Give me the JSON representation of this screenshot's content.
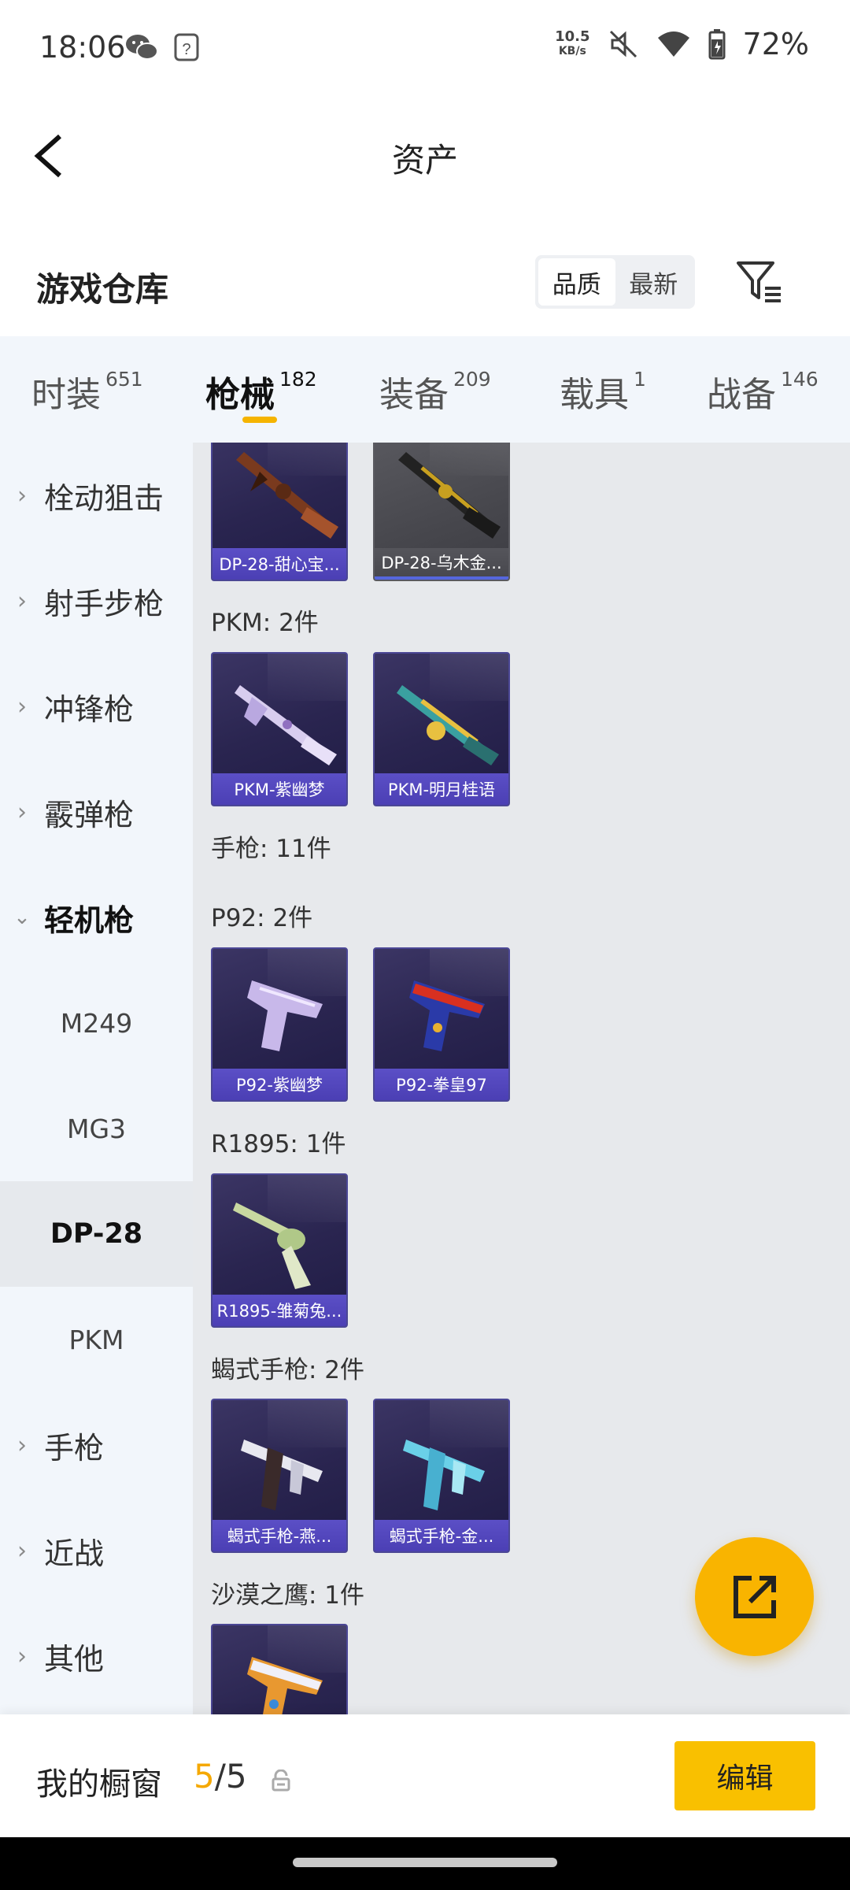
{
  "status_bar": {
    "time": "18:06",
    "net_speed_value": "10.5",
    "net_speed_unit": "KB/s",
    "battery": "72%"
  },
  "header": {
    "title": "资产"
  },
  "warehouse": {
    "title": "游戏仓库",
    "sort_options": [
      "品质",
      "最新"
    ],
    "active_sort": "品质"
  },
  "category_tabs": [
    {
      "label": "时装",
      "count": "651"
    },
    {
      "label": "枪械",
      "count": "182"
    },
    {
      "label": "装备",
      "count": "209"
    },
    {
      "label": "载具",
      "count": "1"
    },
    {
      "label": "战备",
      "count": "146"
    }
  ],
  "active_tab": "枪械",
  "sidebar": {
    "items": [
      {
        "label": "栓动狙击"
      },
      {
        "label": "射手步枪"
      },
      {
        "label": "冲锋枪"
      },
      {
        "label": "霰弹枪"
      },
      {
        "label": "轻机枪"
      },
      {
        "label": "M249"
      },
      {
        "label": "MG3"
      },
      {
        "label": "DP-28"
      },
      {
        "label": "PKM"
      },
      {
        "label": "手枪"
      },
      {
        "label": "近战"
      },
      {
        "label": "其他"
      }
    ],
    "selected": "DP-28"
  },
  "content": {
    "groups": [
      {
        "label": "PKM: 2件"
      },
      {
        "label": "手枪: 11件"
      },
      {
        "label": "P92: 2件"
      },
      {
        "label": "R1895: 1件"
      },
      {
        "label": "蝎式手枪: 2件"
      },
      {
        "label": "沙漠之鹰: 1件"
      }
    ],
    "cards": [
      {
        "name": "DP-28-甜心宝..."
      },
      {
        "name": "DP-28-乌木金..."
      },
      {
        "name": "PKM-紫幽梦"
      },
      {
        "name": "PKM-明月桂语"
      },
      {
        "name": "P92-紫幽梦"
      },
      {
        "name": "P92-拳皇97"
      },
      {
        "name": "R1895-雏菊兔..."
      },
      {
        "name": "蝎式手枪-燕..."
      },
      {
        "name": "蝎式手枪-金..."
      },
      {
        "name": ""
      }
    ]
  },
  "bottom_bar": {
    "my_window_label": "我的橱窗",
    "count_current": "5",
    "count_sep": "/",
    "count_total": "5",
    "edit_label": "编辑"
  },
  "colors": {
    "accent": "#f9b400",
    "card_name_bar": "#4b3fb4",
    "card_bg": "#2a2550"
  }
}
